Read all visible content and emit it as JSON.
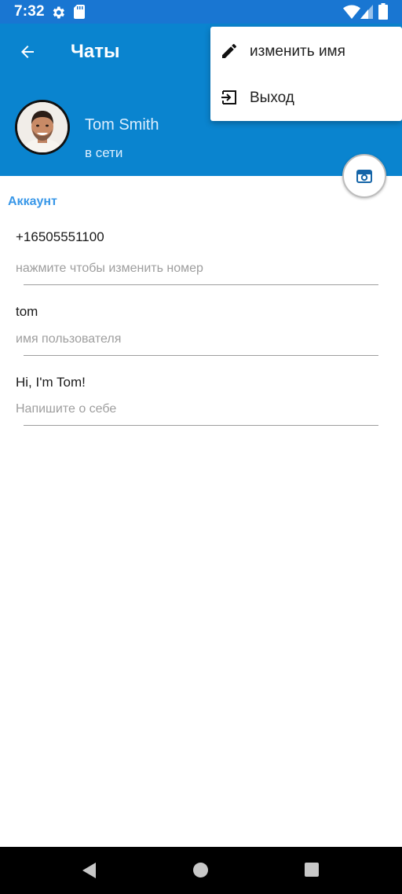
{
  "status_bar": {
    "time": "7:32",
    "icons": [
      "gear-icon",
      "sd-card-icon",
      "wifi-icon",
      "signal-icon",
      "battery-icon"
    ]
  },
  "header": {
    "back_icon": "arrow-left-icon",
    "title": "Чаты",
    "background_color": "#0a84cf"
  },
  "profile": {
    "name": "Tom Smith",
    "status": "в сети"
  },
  "fab": {
    "icon": "camera-icon"
  },
  "account": {
    "section_title": "Аккаунт",
    "fields": [
      {
        "value": "+16505551100",
        "hint": "нажмите чтобы изменить номер"
      },
      {
        "value": "tom",
        "hint": "имя пользователя"
      },
      {
        "value": "Hi, I'm Tom!",
        "hint": "Напишите о себе"
      }
    ]
  },
  "menu": {
    "items": [
      {
        "icon": "pencil-icon",
        "label": "изменить имя"
      },
      {
        "icon": "logout-icon",
        "label": "Выход"
      }
    ]
  },
  "nav_bar": {
    "icons": [
      "back-triangle-icon",
      "home-circle-icon",
      "recents-square-icon"
    ]
  },
  "colors": {
    "status_bar": "#1976d2",
    "accent": "#3897e8",
    "text_primary": "#1a1a1a",
    "text_hint": "#9e9e9e"
  }
}
